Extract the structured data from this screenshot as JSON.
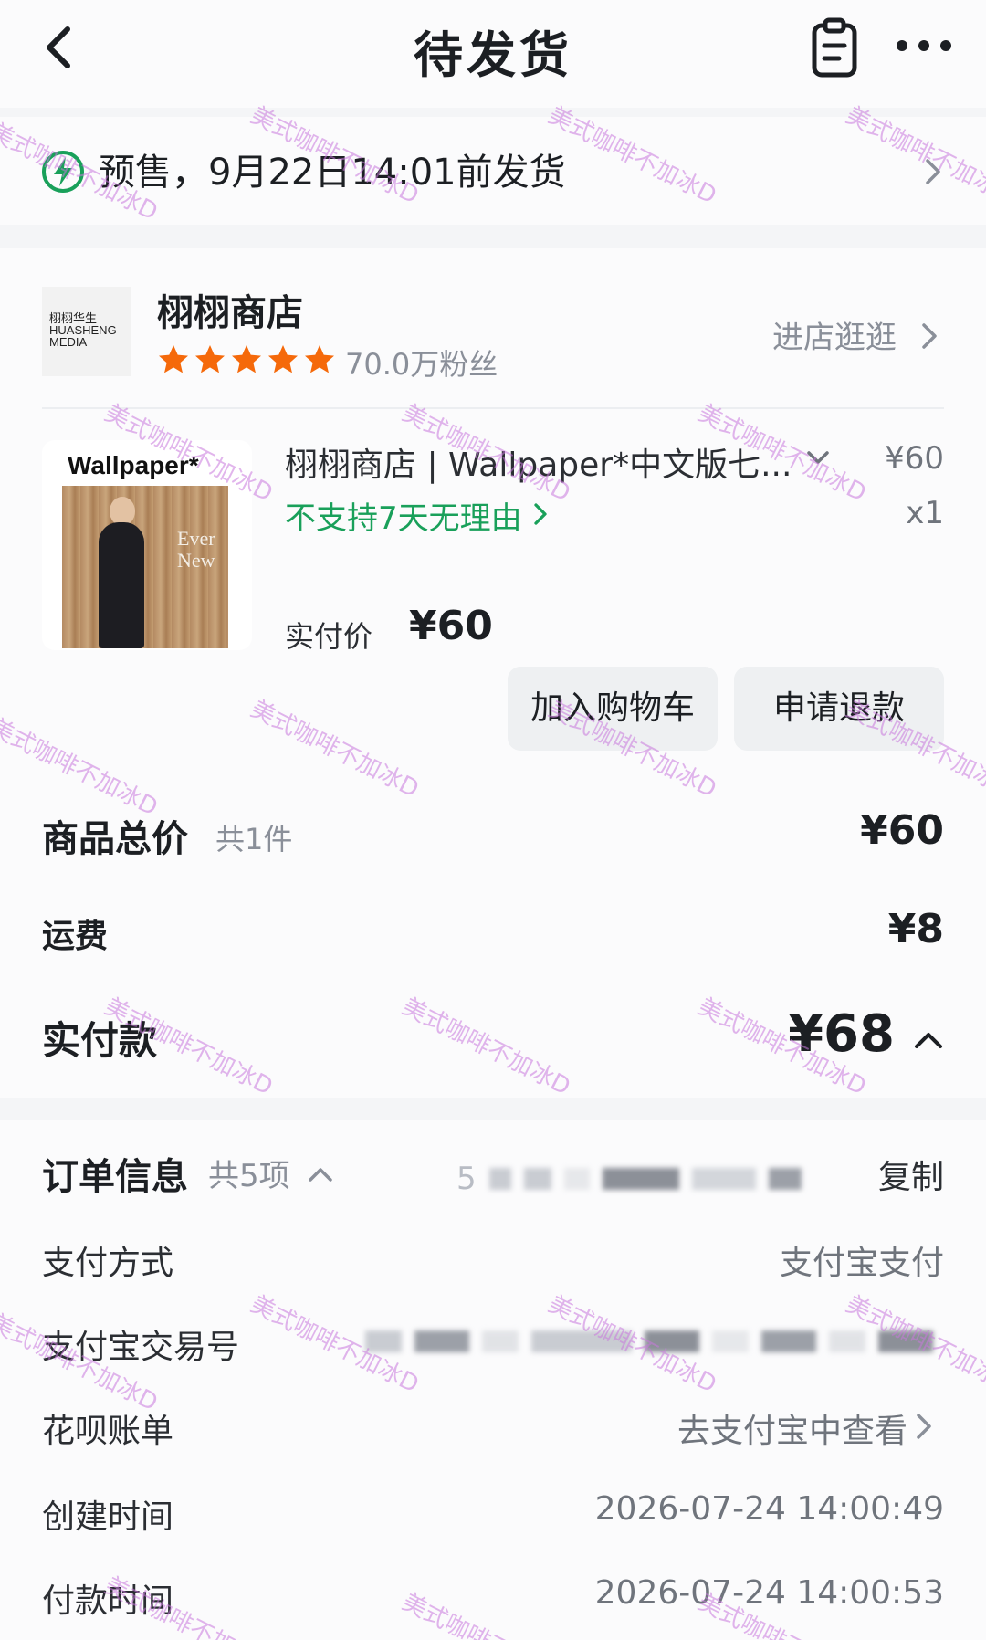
{
  "header": {
    "title": "待发货",
    "back_icon": "chevron-left-icon",
    "clipboard_icon": "clipboard-icon",
    "more_icon": "more-horizontal-icon"
  },
  "presale": {
    "icon": "lightning-circle-icon",
    "text": "预售，9月22日14:01前发货"
  },
  "shop": {
    "logo_text": "栩栩华生\nHUASHENG\nMEDIA",
    "name": "栩栩商店",
    "rating_stars": 5,
    "fans": "70.0万粉丝",
    "enter_label": "进店逛逛"
  },
  "product": {
    "image_title": "Wallpaper*",
    "image_text": "Ever\nNew",
    "name": "栩栩商店 | Wallpaper*中文版七...",
    "price": "¥60",
    "quantity": "x1",
    "return_policy": "不支持7天无理由",
    "paid_label": "实付价",
    "paid_amount": "¥60",
    "actions": {
      "add_to_cart": "加入购物车",
      "refund": "申请退款"
    }
  },
  "summary": {
    "goods_total_label": "商品总价",
    "goods_count": "共1件",
    "goods_total": "¥60",
    "shipping_label": "运费",
    "shipping": "¥8",
    "actual_paid_label": "实付款",
    "actual_paid": "¥68"
  },
  "order_info": {
    "title": "订单信息",
    "count": "共5项",
    "order_no_partial": "5",
    "copy_label": "复制",
    "rows": [
      {
        "label": "支付方式",
        "value": "支付宝支付"
      },
      {
        "label": "支付宝交易号",
        "value": ""
      },
      {
        "label": "花呗账单",
        "value": "去支付宝中查看"
      },
      {
        "label": "创建时间",
        "value": "2026-07-24 14:00:49"
      },
      {
        "label": "付款时间",
        "value": "2026-07-24 14:00:53"
      }
    ]
  },
  "watermark": "美式咖啡不加冰D",
  "colors": {
    "star": "#f5690a",
    "green_notice": "#19a05a",
    "muted_text": "#8a8f99",
    "watermark": "#c878dc"
  }
}
